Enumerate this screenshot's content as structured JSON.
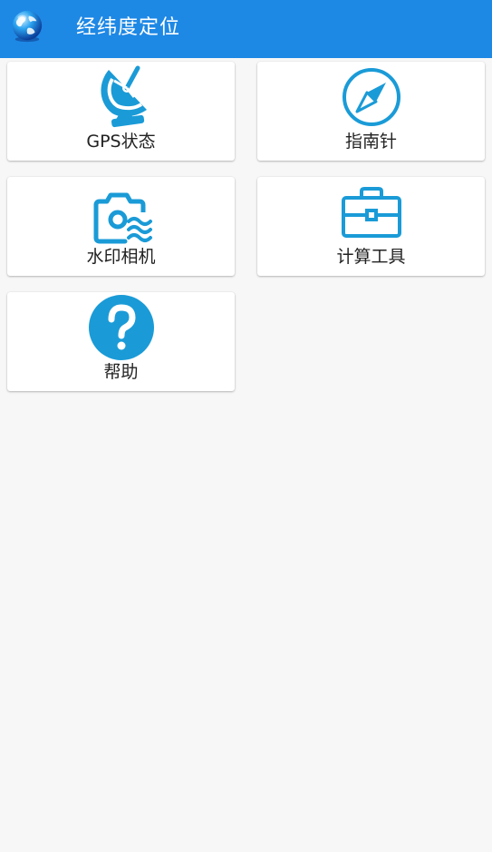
{
  "header": {
    "title": "经纬度定位",
    "logo_icon": "globe-icon",
    "background_color": "#1e88e5"
  },
  "menu": {
    "items": [
      {
        "label": "GPS状态",
        "icon": "satellite-dish-icon"
      },
      {
        "label": "指南针",
        "icon": "compass-icon"
      },
      {
        "label": "水印相机",
        "icon": "watermark-camera-icon"
      },
      {
        "label": "计算工具",
        "icon": "toolbox-icon"
      },
      {
        "label": "帮助",
        "icon": "help-icon"
      }
    ]
  },
  "colors": {
    "accent": "#1a9bd7",
    "page_background": "#f7f7f7",
    "card_background": "#ffffff"
  }
}
